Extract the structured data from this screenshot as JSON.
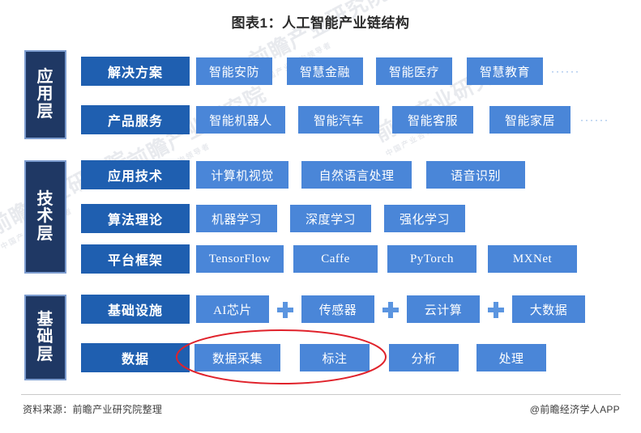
{
  "title": "图表1：人工智能产业链结构",
  "footer": {
    "source": "资料来源：前瞻产业研究院整理",
    "brand": "@前瞻经济学人APP"
  },
  "watermark": {
    "main": "前瞻产业研究院",
    "sub": "中国产业咨询领导者"
  },
  "colors": {
    "layer_label_bg": "#1f3864",
    "layer_label_border": "#7c9ccf",
    "category_bg": "#1f5fb0",
    "item_bg": "#4a86d8",
    "item_bg_light": "#5b95e0",
    "dots": "#6d9ee0",
    "plus": "#5b95e0",
    "annotation": "#e0222b"
  },
  "layers": [
    {
      "label": "应用层",
      "label_chars": [
        "应",
        "用",
        "层"
      ],
      "rows": [
        {
          "category": "解决方案",
          "items": [
            "智能安防",
            "智慧金融",
            "智能医疗",
            "智慧教育"
          ],
          "trailing": "······"
        },
        {
          "category": "产品服务",
          "items": [
            "智能机器人",
            "智能汽车",
            "智能客服",
            "智能家居"
          ],
          "trailing": "······"
        }
      ]
    },
    {
      "label": "技术层",
      "label_chars": [
        "技",
        "术",
        "层"
      ],
      "rows": [
        {
          "category": "应用技术",
          "items": [
            "计算机视觉",
            "自然语言处理",
            "语音识别"
          ],
          "trailing": ""
        },
        {
          "category": "算法理论",
          "items": [
            "机器学习",
            "深度学习",
            "强化学习"
          ],
          "trailing": ""
        },
        {
          "category": "平台框架",
          "items": [
            "TensorFlow",
            "Caffe",
            "PyTorch",
            "MXNet"
          ],
          "trailing": ""
        }
      ]
    },
    {
      "label": "基础层",
      "label_chars": [
        "基",
        "础",
        "层"
      ],
      "rows": [
        {
          "category": "基础设施",
          "items": [
            "AI芯片",
            "传感器",
            "云计算",
            "大数据"
          ],
          "separators": [
            "+",
            "+",
            "+"
          ],
          "trailing": ""
        },
        {
          "category": "数据",
          "items": [
            "数据采集",
            "标注",
            "分析",
            "处理"
          ],
          "trailing": ""
        }
      ]
    }
  ],
  "annotation": {
    "type": "ellipse",
    "highlights": [
      "数据采集",
      "标注"
    ]
  }
}
